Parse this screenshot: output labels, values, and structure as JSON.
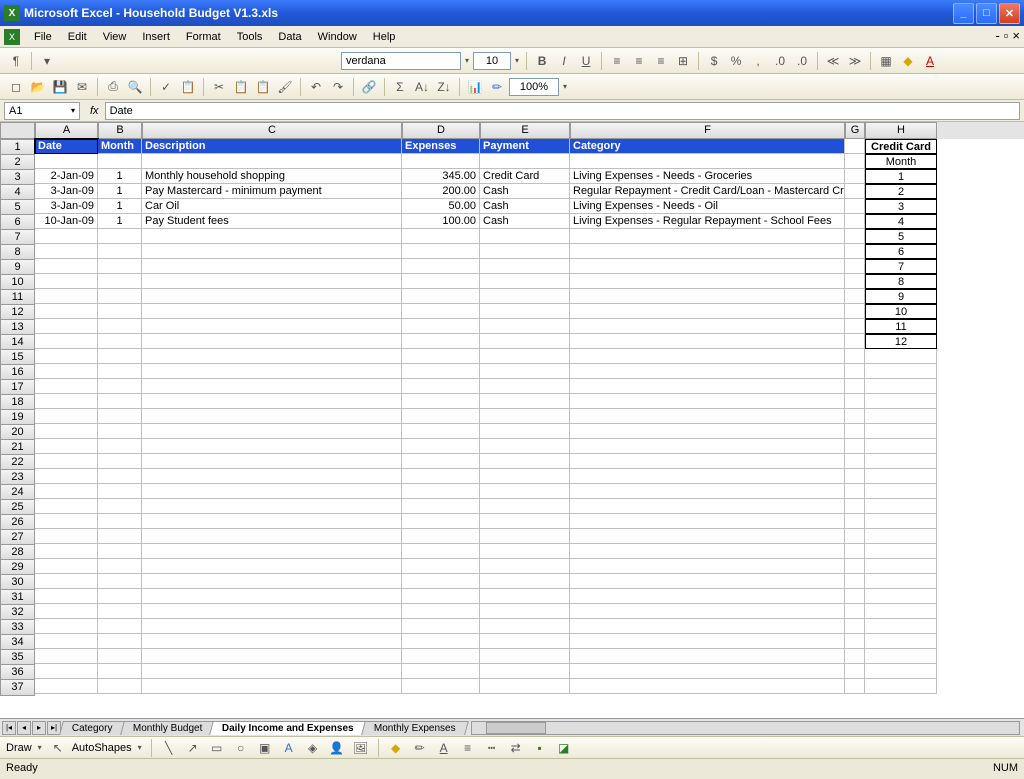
{
  "window": {
    "title": "Microsoft Excel - Household Budget V1.3.xls"
  },
  "menu": {
    "file": "File",
    "edit": "Edit",
    "view": "View",
    "insert": "Insert",
    "format": "Format",
    "tools": "Tools",
    "data": "Data",
    "window": "Window",
    "help": "Help"
  },
  "formatting": {
    "font_name": "verdana",
    "font_size": "10",
    "zoom": "100%"
  },
  "namebox": {
    "cell_ref": "A1",
    "formula_value": "Date",
    "fx": "fx"
  },
  "columns": {
    "A": "A",
    "B": "B",
    "C": "C",
    "D": "D",
    "E": "E",
    "F": "F",
    "G": "G",
    "H": "H"
  },
  "headers": {
    "date": "Date",
    "month": "Month",
    "description": "Description",
    "expenses": "Expenses",
    "payment": "Payment",
    "category": "Category",
    "credit_card": "Credit Card",
    "month_h": "Month"
  },
  "rows": [
    {
      "date": "2-Jan-09",
      "month": "1",
      "desc": "Monthly household shopping",
      "exp": "345.00",
      "pay": "Credit Card",
      "cat": "Living Expenses - Needs - Groceries"
    },
    {
      "date": "3-Jan-09",
      "month": "1",
      "desc": "Pay Mastercard - minimum payment",
      "exp": "200.00",
      "pay": "Cash",
      "cat": "Regular Repayment - Credit Card/Loan - Mastercard Cred"
    },
    {
      "date": "3-Jan-09",
      "month": "1",
      "desc": "Car Oil",
      "exp": "50.00",
      "pay": "Cash",
      "cat": "Living Expenses - Needs - Oil"
    },
    {
      "date": "10-Jan-09",
      "month": "1",
      "desc": "Pay Student fees",
      "exp": "100.00",
      "pay": "Cash",
      "cat": "Living Expenses - Regular Repayment - School Fees"
    }
  ],
  "side_months": [
    "1",
    "2",
    "3",
    "4",
    "5",
    "6",
    "7",
    "8",
    "9",
    "10",
    "11",
    "12"
  ],
  "tabs": {
    "category": "Category",
    "monthly_budget": "Monthly Budget",
    "daily": "Daily Income and Expenses",
    "monthly_exp": "Monthly Expenses"
  },
  "drawbar": {
    "draw": "Draw",
    "autoshapes": "AutoShapes"
  },
  "status": {
    "ready": "Ready",
    "num": "NUM"
  }
}
